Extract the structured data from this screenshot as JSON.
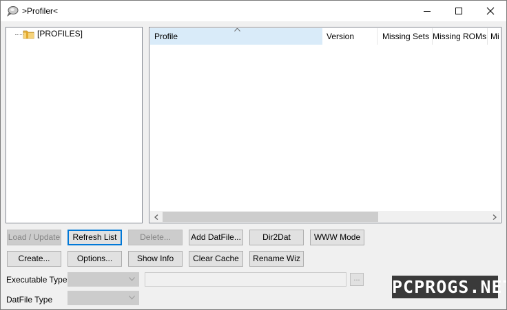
{
  "window": {
    "title": ">Profiler<"
  },
  "tree": {
    "root_label": "[PROFILES]"
  },
  "list": {
    "columns": [
      "Profile",
      "Version",
      "Missing Sets",
      "Missing ROMs",
      "Mi"
    ],
    "sorted_column": "Profile"
  },
  "buttons": {
    "row1": [
      "Load / Update",
      "Refresh List",
      "Delete...",
      "Add DatFile...",
      "Dir2Dat",
      "WWW Mode"
    ],
    "row2": [
      "Create...",
      "Options...",
      "Show Info",
      "Clear Cache",
      "Rename Wiz"
    ]
  },
  "fields": {
    "executable_type_label": "Executable Type",
    "datfile_type_label": "DatFile Type",
    "browse_label": "..."
  },
  "watermark": "PCPROGS.NET",
  "colors": {
    "sorted_header": "#d9ebf9",
    "focus_border": "#0078d7",
    "disabled_text": "#838383"
  }
}
